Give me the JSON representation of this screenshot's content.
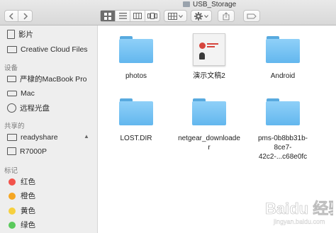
{
  "window": {
    "title": "USB_Storage"
  },
  "toolbar": {
    "back_icon": "chevron-left-icon",
    "forward_icon": "chevron-right-icon",
    "views": [
      "icon-view",
      "list-view",
      "column-view",
      "cover-flow-view"
    ],
    "active_view": "icon-view",
    "arrange_icon": "grid-arrange-icon",
    "action_icon": "gear-icon",
    "share_icon": "share-icon",
    "tag_icon": "tag-icon"
  },
  "sidebar": {
    "favorites": [
      {
        "label": "影片",
        "icon": "film-icon"
      },
      {
        "label": "Creative Cloud Files",
        "icon": "folder-icon"
      }
    ],
    "devices_header": "设备",
    "devices": [
      {
        "label": "严棣的MacBook Pro",
        "icon": "laptop-icon"
      },
      {
        "label": "Mac",
        "icon": "disk-icon"
      },
      {
        "label": "远程光盘",
        "icon": "disc-icon"
      }
    ],
    "shared_header": "共享的",
    "shared": [
      {
        "label": "readyshare",
        "icon": "monitor-icon",
        "eject": "▲"
      },
      {
        "label": "R7000P",
        "icon": "router-icon"
      }
    ],
    "tags_header": "标记",
    "tags": [
      {
        "label": "红色",
        "color": "#f2534b"
      },
      {
        "label": "橙色",
        "color": "#f5a623"
      },
      {
        "label": "黄色",
        "color": "#f6d03f"
      },
      {
        "label": "绿色",
        "color": "#5ac95c"
      }
    ]
  },
  "files": [
    {
      "name": "photos",
      "kind": "folder"
    },
    {
      "name": "演示文稿2",
      "kind": "document"
    },
    {
      "name": "Android",
      "kind": "folder"
    },
    {
      "name": "LOST.DIR",
      "kind": "folder"
    },
    {
      "name": "netgear_downloader",
      "kind": "folder"
    },
    {
      "name": "pms-0b8bb31b-8ce7-42c2-...c68e0fc",
      "kind": "folder"
    }
  ],
  "watermark": {
    "text": "Baidu 经验",
    "sub": "jingyan.baidu.com"
  }
}
